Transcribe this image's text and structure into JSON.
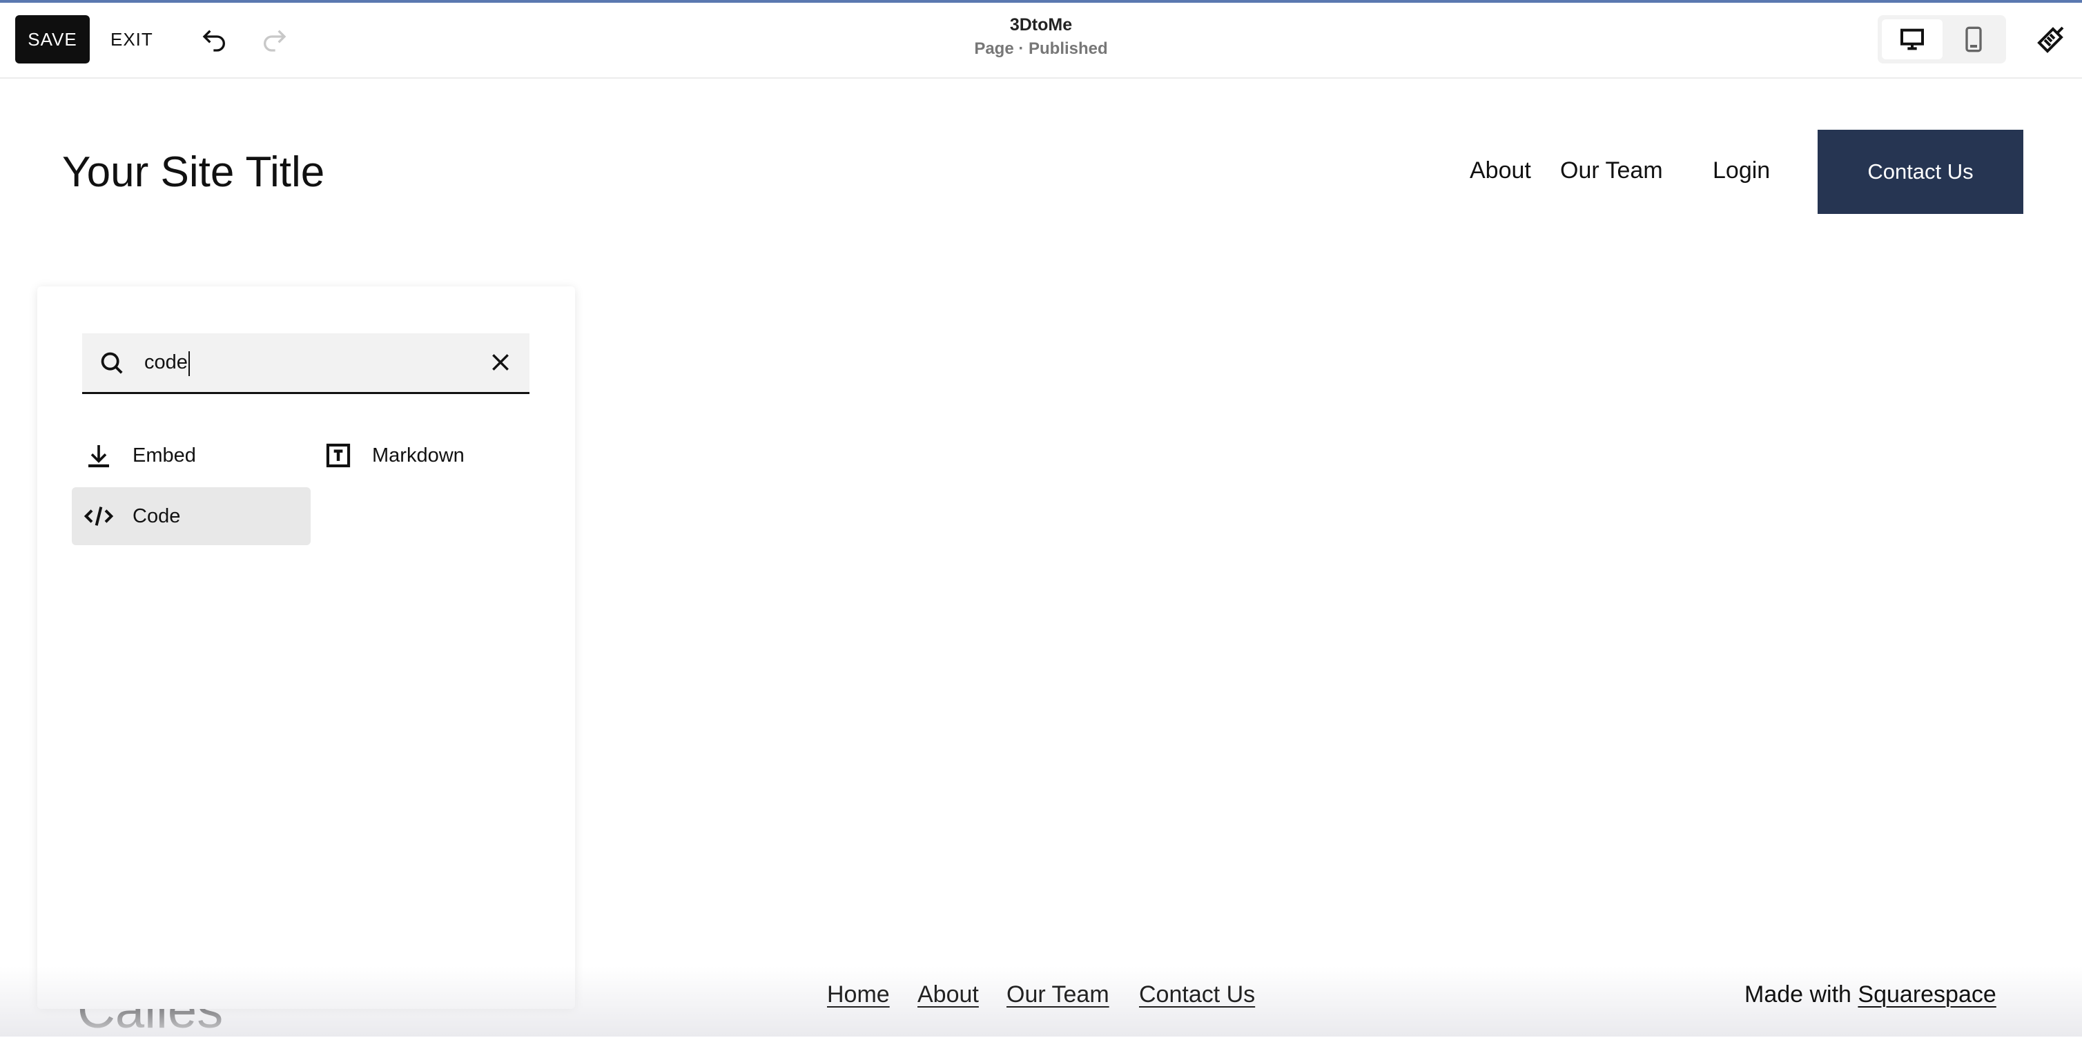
{
  "toolbar": {
    "save_label": "SAVE",
    "exit_label": "EXIT",
    "site_name": "3DtoMe",
    "page_status": "Page · Published",
    "accent_color": "#5a78b0"
  },
  "site": {
    "title": "Your Site Title",
    "nav": [
      "About",
      "Our Team",
      "Login"
    ],
    "cta_label": "Contact Us",
    "cta_color": "#263552",
    "partial_heading": "Calles"
  },
  "block_picker": {
    "search_value": "code",
    "results": [
      {
        "label": "Embed",
        "icon": "download-icon"
      },
      {
        "label": "Markdown",
        "icon": "text-box-icon"
      },
      {
        "label": "Code",
        "icon": "code-icon",
        "highlighted": true
      }
    ]
  },
  "footer": {
    "links": [
      "Home",
      "About",
      "Our Team",
      "Contact Us"
    ],
    "made_with": "Made with",
    "made_with_link": "Squarespace"
  }
}
